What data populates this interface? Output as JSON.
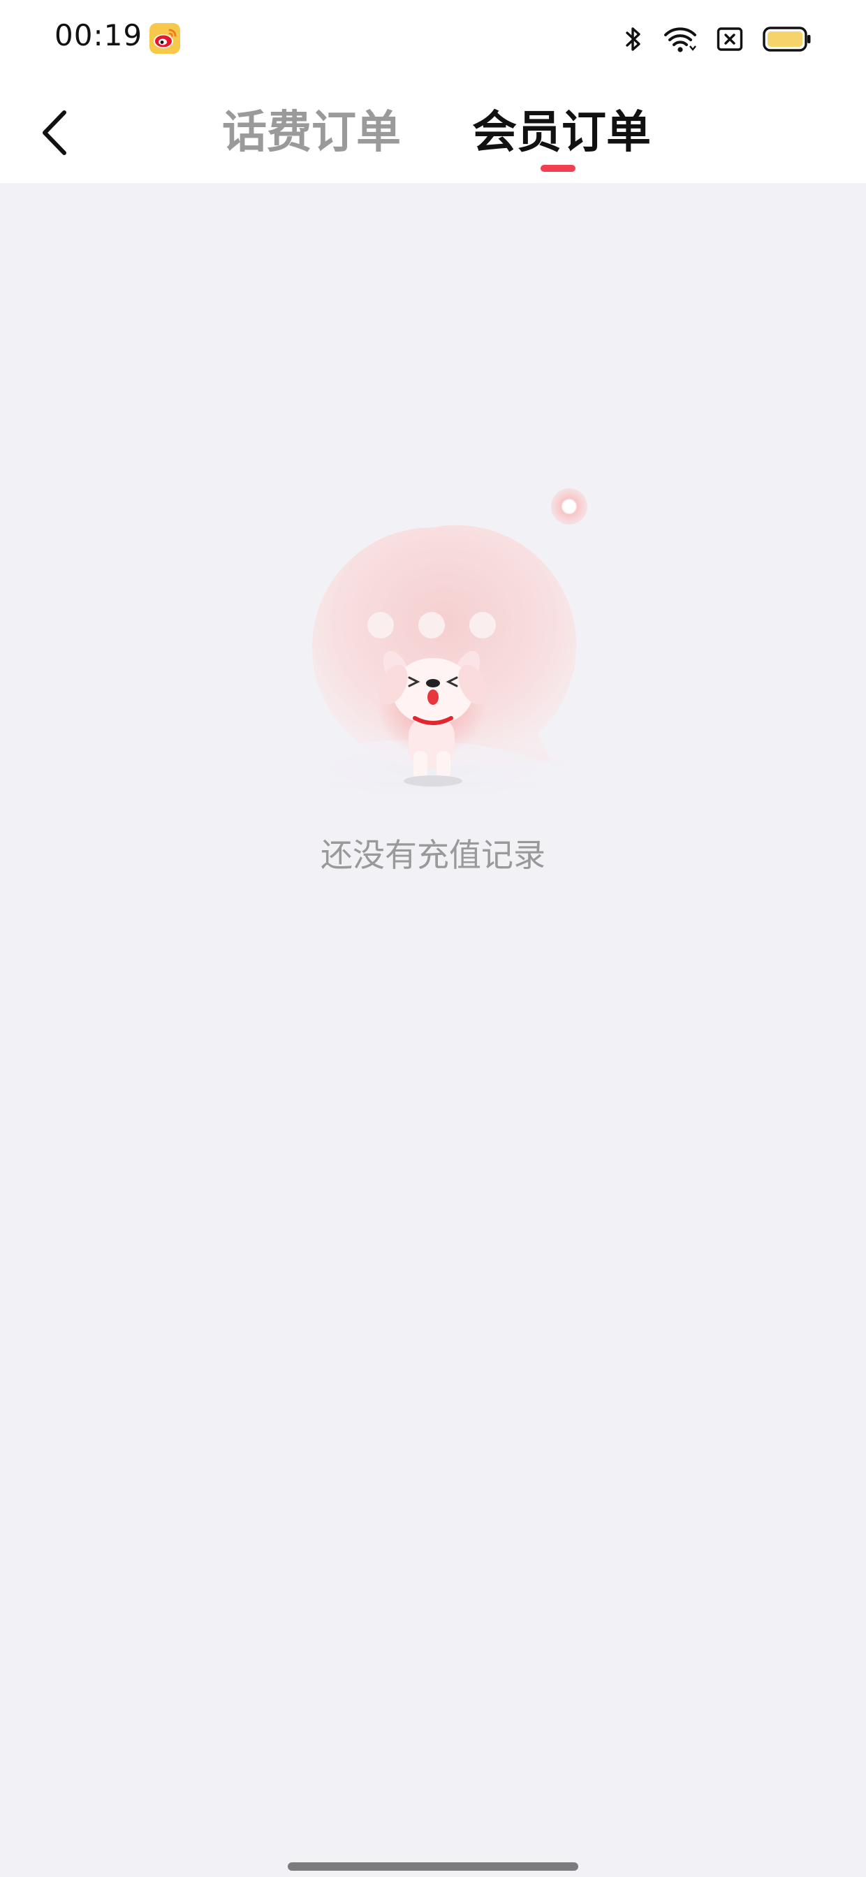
{
  "status_bar": {
    "time": "00:19",
    "icons": [
      "weibo-icon",
      "bluetooth-icon",
      "wifi-icon",
      "sim-off-icon",
      "battery-icon"
    ],
    "battery_color": "#f6d36b"
  },
  "nav": {
    "back_icon": "chevron-left-icon",
    "tabs": [
      {
        "label": "话费订单",
        "active": false
      },
      {
        "label": "会员订单",
        "active": true
      }
    ],
    "accent_color": "#f23f4f"
  },
  "empty_state": {
    "illustration": "joy-dog-empty-illustration",
    "message": "还没有充值记录"
  }
}
